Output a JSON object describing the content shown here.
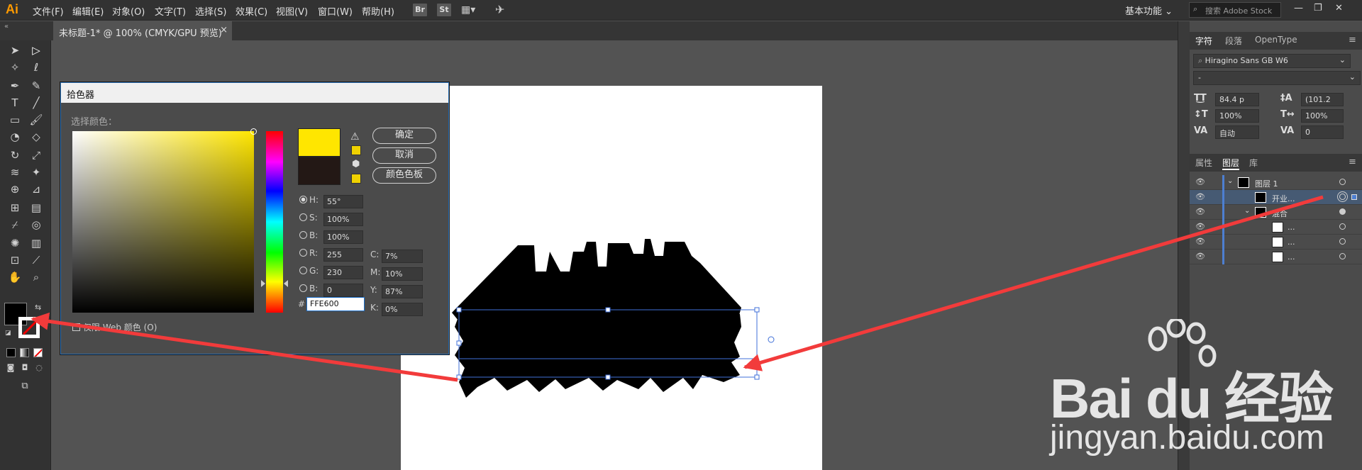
{
  "app": {
    "logo": "Ai",
    "accent": "#ff9a00"
  },
  "menu": {
    "items": [
      "文件(F)",
      "编辑(E)",
      "对象(O)",
      "文字(T)",
      "选择(S)",
      "效果(C)",
      "视图(V)",
      "窗口(W)",
      "帮助(H)"
    ]
  },
  "app_buttons": [
    "Br",
    "St"
  ],
  "workspace": {
    "label": "基本功能 ⌄"
  },
  "search": {
    "placeholder": "搜索 Adobe Stock"
  },
  "window_controls": {
    "minimize": "—",
    "restore": "❐",
    "close": "✕"
  },
  "document_tab": {
    "title": "未标题-1* @ 100% (CMYK/GPU 预览)",
    "close": "×"
  },
  "tools": {
    "icons": [
      "selection-tool",
      "direct-selection-tool",
      "magic-wand-tool",
      "lasso-tool",
      "pen-tool",
      "curvature-tool",
      "type-tool",
      "line-tool",
      "rectangle-tool",
      "paintbrush-tool",
      "shaper-tool",
      "eraser-tool",
      "rotate-tool",
      "scale-tool",
      "width-tool",
      "puppet-warp-tool",
      "shape-builder-tool",
      "perspective-grid-tool",
      "mesh-tool",
      "gradient-tool",
      "eyedropper-tool",
      "blend-tool",
      "symbol-sprayer-tool",
      "column-graph-tool",
      "artboard-tool",
      "slice-tool",
      "hand-tool",
      "zoom-tool"
    ]
  },
  "color_picker": {
    "title": "拾色器",
    "select_label": "选择颜色：",
    "ok": "确定",
    "cancel": "取消",
    "swatches": "颜色色板",
    "h_label": "H:",
    "h": "55°",
    "s_label": "S:",
    "s": "100%",
    "b_label": "B:",
    "b": "100%",
    "r_label": "R:",
    "r": "255",
    "g_label": "G:",
    "g": "230",
    "bl_label": "B:",
    "bl": "0",
    "c_label": "C:",
    "c": "7%",
    "m_label": "M:",
    "m": "10%",
    "y_label": "Y:",
    "y": "87%",
    "k_label": "K:",
    "k": "0%",
    "hex_label": "#",
    "hex": "FFE600",
    "web_only": "仅限 Web 颜色 (O)",
    "new_color": "#ffe600",
    "old_color": "#231815"
  },
  "character_panel": {
    "tabs": [
      "字符",
      "段落",
      "OpenType"
    ],
    "font_family": "Hiragino Sans GB W6",
    "font_style": "-",
    "size": "84.4 p",
    "leading": "(101.2",
    "vscale": "100%",
    "hscale": "100%",
    "kerning": "自动",
    "tracking": "0"
  },
  "layers_panel": {
    "tabs": [
      "属性",
      "图层",
      "库"
    ],
    "rows": [
      {
        "name": "图层 1"
      },
      {
        "name": "开业..."
      },
      {
        "name": "混合"
      },
      {
        "name": "..."
      },
      {
        "name": "..."
      },
      {
        "name": "..."
      }
    ]
  },
  "watermark": {
    "main": "Bai du 经验",
    "sub": "jingyan.baidu.com"
  }
}
